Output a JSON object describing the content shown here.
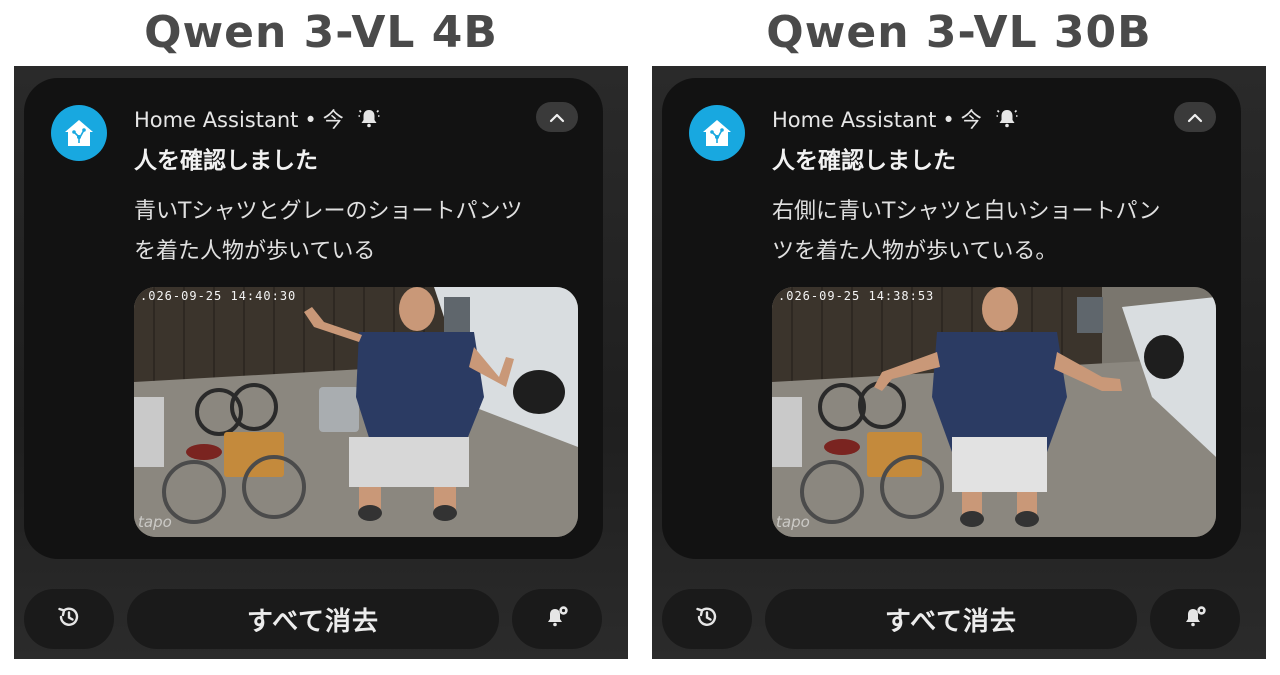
{
  "columns": [
    {
      "title": "Qwen 3-VL 4B",
      "notification": {
        "app_name": "Home Assistant",
        "separator": "•",
        "time": "今",
        "title": "人を確認しました",
        "body_line1": "青いTシャツとグレーのショートパンツ",
        "body_line2": "を着た人物が歩いている",
        "snapshot": {
          "timestamp": ".026-09-25 14:40:30",
          "watermark": "tapo"
        }
      },
      "actions": {
        "clear_all": "すべて消去"
      }
    },
    {
      "title": "Qwen 3-VL 30B",
      "notification": {
        "app_name": "Home Assistant",
        "separator": "•",
        "time": "今",
        "title": "人を確認しました",
        "body_line1": "右側に青いTシャツと白いショートパン",
        "body_line2": "ツを着た人物が歩いている。",
        "snapshot": {
          "timestamp": ".026-09-25 14:38:53",
          "watermark": "tapo"
        }
      },
      "actions": {
        "clear_all": "すべて消去"
      }
    }
  ],
  "icons": {
    "app": "home-assistant-icon",
    "alert": "bell-ringing-icon",
    "collapse": "chevron-up-icon",
    "history": "history-icon",
    "settings": "bell-settings-icon"
  },
  "colors": {
    "app_icon_bg": "#18a8e0",
    "card_bg": "#121212",
    "panel_bg": "#242424"
  }
}
